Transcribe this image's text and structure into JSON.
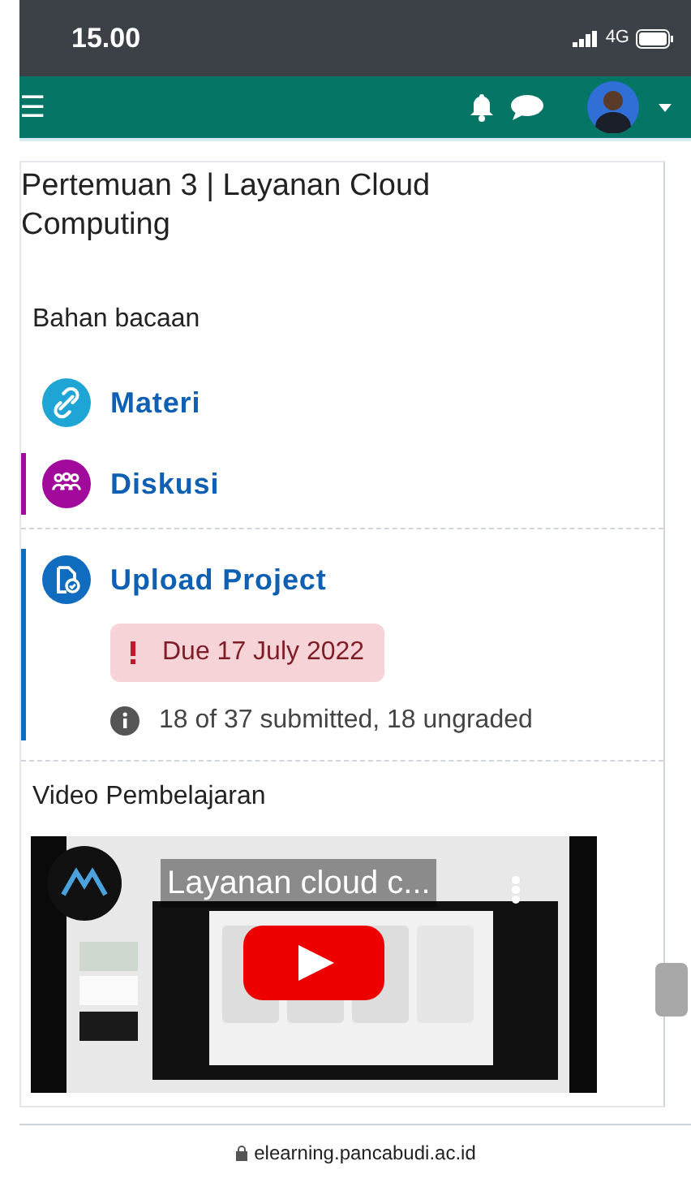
{
  "status_bar": {
    "time": "15.00",
    "network": "4G"
  },
  "navbar": {
    "menu_icon": "☰"
  },
  "section": {
    "title": "Pertemuan 3 | Layanan Cloud Computing",
    "label": "Bahan bacaan",
    "activities": [
      {
        "kind": "url",
        "name": "Materi",
        "color": "#1ea5d6"
      },
      {
        "kind": "forum",
        "name": "Diskusi",
        "color": "#a10a9b"
      },
      {
        "kind": "assign",
        "name": "Upload Project",
        "color": "#0f6cbf",
        "due": "Due 17 July 2022",
        "info": "18 of 37 submitted, 18 ungraded"
      }
    ],
    "video_label": "Video Pembelajaran",
    "video": {
      "kind": "picture",
      "title": "Layanan cloud c..."
    }
  },
  "footer": {
    "url": "elearning.pancabudi.ac.id"
  }
}
